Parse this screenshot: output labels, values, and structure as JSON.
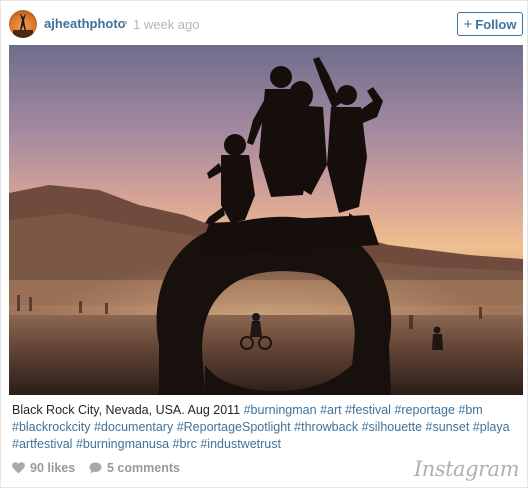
{
  "post": {
    "username": "ajheathphoto",
    "separator": "•",
    "timestamp": "1 week ago",
    "follow_label": "Follow"
  },
  "caption": {
    "text": "Black Rock City, Nevada, USA. Aug 2011",
    "hashtags": [
      "#burningman",
      "#art",
      "#festival",
      "#reportage",
      "#bm",
      "#blackrockcity",
      "#documentary",
      "#ReportageSpotlight",
      "#throwback",
      "#silhouette",
      "#sunset",
      "#playa",
      "#artfestival",
      "#burningmanusa",
      "#brc",
      "#industwetrust"
    ]
  },
  "footer": {
    "likes": "90 likes",
    "comments": "5 comments",
    "brand": "Instagram"
  },
  "icons": {
    "follow": "plus-icon",
    "likes": "heart-icon",
    "comments": "comment-bubble-icon"
  },
  "colors": {
    "link": "#3f729b",
    "muted": "#999999",
    "timestamp": "#b5b5b5"
  }
}
